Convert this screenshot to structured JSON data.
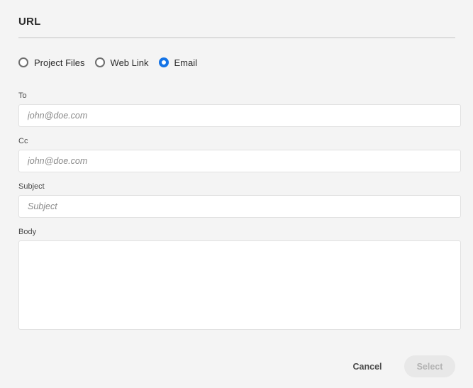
{
  "dialog": {
    "title": "URL",
    "link_type": {
      "options": [
        {
          "label": "Project Files",
          "selected": false
        },
        {
          "label": "Web Link",
          "selected": false
        },
        {
          "label": "Email",
          "selected": true
        }
      ]
    },
    "fields": {
      "to": {
        "label": "To",
        "value": "",
        "placeholder": "john@doe.com"
      },
      "cc": {
        "label": "Cc",
        "value": "",
        "placeholder": "john@doe.com"
      },
      "subject": {
        "label": "Subject",
        "value": "",
        "placeholder": "Subject"
      },
      "body": {
        "label": "Body",
        "value": ""
      }
    },
    "buttons": {
      "cancel": "Cancel",
      "select": "Select"
    }
  },
  "colors": {
    "accent": "#1473e6",
    "background": "#f4f4f4"
  }
}
